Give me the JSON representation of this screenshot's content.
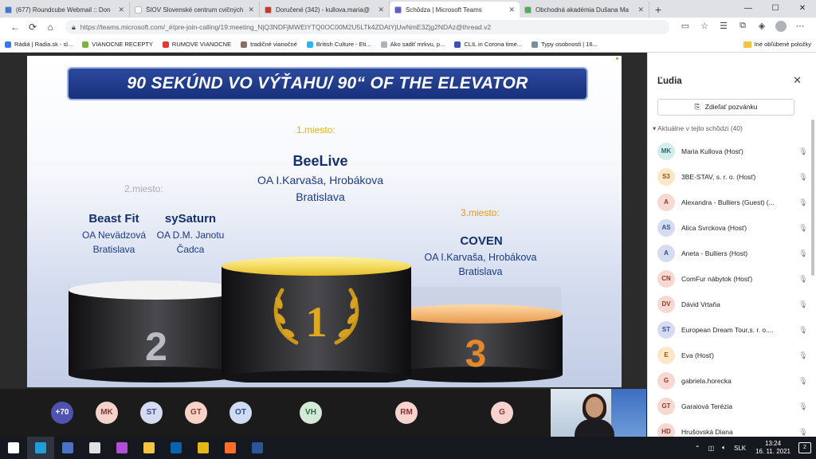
{
  "browser": {
    "tabs": [
      {
        "label": "(677) Roundcube Webmail :: Don",
        "color": "#3b78e7",
        "active": false
      },
      {
        "label": "ŠIOV Slovenské centrum cvičných",
        "color": "#ffffff",
        "active": false
      },
      {
        "label": "Doručené (342) - kullova.maria@",
        "color": "#d93025",
        "active": false
      },
      {
        "label": "Schôdza | Microsoft Teams",
        "color": "#5b5fc7",
        "active": true
      },
      {
        "label": "Obchodná akadémia Dušana Ma",
        "color": "#4caf50",
        "active": false
      }
    ],
    "url": "https://teams.microsoft.com/_#/pre-join-calling/19:meeting_NjQ3NDFjMWEtYTQ0OC00M2U5LTk4ZDAtYjUwNmE3Zjg2NDAz@thread.v2",
    "bookmarks": [
      {
        "label": "Rádiá | Radia.sk - sl...",
        "color": "#3b78e7"
      },
      {
        "label": "VIANOCNE RECEPTY",
        "color": "#7cb342"
      },
      {
        "label": "RUMOVE VIANOCNE",
        "color": "#e53935"
      },
      {
        "label": "tradičné vianočné",
        "color": "#8d6e63"
      },
      {
        "label": "British Culture - Eti...",
        "color": "#29b6f6"
      },
      {
        "label": "Ako sadiť mrkvu, p...",
        "color": "#aab4be"
      },
      {
        "label": "CLIL in Corona time...",
        "color": "#3f51b5"
      },
      {
        "label": "Typy osobnosti | 16...",
        "color": "#78909c"
      }
    ],
    "other_bookmarks": "Iné obľúbené položky"
  },
  "slide": {
    "title": "90 SEKÚND VO VÝŤAHU/ 90“ OF THE ELEVATOR",
    "first_place_label": "1.miesto:",
    "second_place_label": "2.miesto:",
    "third_place_label": "3.miesto:",
    "first": {
      "team": "BeeLive",
      "school": "OA I.Karvaša, Hrobákova",
      "city": "Bratislava"
    },
    "second_a": {
      "team": "Beast Fit",
      "school": "OA Nevädzová",
      "city": "Bratislava"
    },
    "second_b": {
      "team": "sySaturn",
      "school": "OA D.M. Janotu",
      "city": "Čadca"
    },
    "third": {
      "team": "COVEN",
      "school": "OA I.Karvaša, Hrobákova",
      "city": "Bratislava"
    },
    "podium_numbers": {
      "first": "1",
      "second": "2",
      "third": "3"
    }
  },
  "strip": {
    "overflow": "+70",
    "avatars": [
      {
        "initials": "MK",
        "bg": "#f4d3cc",
        "fg": "#8a3b2d"
      },
      {
        "initials": "ST",
        "bg": "#d5dcf2",
        "fg": "#3a4e8c"
      },
      {
        "initials": "GT",
        "bg": "#f6d3c6",
        "fg": "#8a3b2d"
      },
      {
        "initials": "OT",
        "bg": "#cfdcf3",
        "fg": "#2f4f8f"
      },
      {
        "initials": "VH",
        "bg": "#d3ead8",
        "fg": "#2f6a3d"
      },
      {
        "initials": "RM",
        "bg": "#f6d3cf",
        "fg": "#8a2f2d"
      },
      {
        "initials": "G",
        "bg": "#f6d3cf",
        "fg": "#8a2f2d"
      }
    ]
  },
  "people_panel": {
    "title": "Ľudia",
    "share_button": "Zdieľať pozvánku",
    "group_header": "Aktuálne v tejto schôdzi (40)",
    "participants": [
      {
        "initials": "MK",
        "name": "Maria Kullova (Hosť)",
        "bg": "#d3ecec",
        "fg": "#2b6b6b"
      },
      {
        "initials": "S3",
        "name": "3BE-STAV, s. r. o. (Hosť)",
        "bg": "#fbe7c6",
        "fg": "#8a5a10"
      },
      {
        "initials": "A",
        "name": "Alexandra - Bulliers (Guest) (...",
        "bg": "#f7d9d2",
        "fg": "#8a3b2d"
      },
      {
        "initials": "AS",
        "name": "Alica Svrckova (Hosť)",
        "bg": "#d5dcf2",
        "fg": "#3a4e8c"
      },
      {
        "initials": "A",
        "name": "Aneta - Bulliers (Host)",
        "bg": "#d5dcf2",
        "fg": "#3a4e8c"
      },
      {
        "initials": "CN",
        "name": "ComFur nábytok (Hosť)",
        "bg": "#f7d9d2",
        "fg": "#8a3b2d"
      },
      {
        "initials": "DV",
        "name": "Dávid Vrtaňa",
        "bg": "#f7d9d2",
        "fg": "#8a3b2d"
      },
      {
        "initials": "ST",
        "name": "European Dream Tour,s. r. o....",
        "bg": "#d5dcf2",
        "fg": "#3a4e8c"
      },
      {
        "initials": "E",
        "name": "Eva (Hosť)",
        "bg": "#fbe7c6",
        "fg": "#8a5a10"
      },
      {
        "initials": "G",
        "name": "gabriela.horecka",
        "bg": "#f7d9d2",
        "fg": "#8a3b2d"
      },
      {
        "initials": "GT",
        "name": "Garaiová Terézia",
        "bg": "#f7d9d2",
        "fg": "#8a3b2d"
      },
      {
        "initials": "HD",
        "name": "Hrušovská Diana",
        "bg": "#f7d9d2",
        "fg": "#8a3b2d"
      }
    ]
  },
  "taskbar": {
    "apps": [
      {
        "name": "windows-start-icon",
        "color": "#ffffff"
      },
      {
        "name": "edge-icon",
        "color": "#1f9ed8"
      },
      {
        "name": "save-icon",
        "color": "#4a72c8"
      },
      {
        "name": "lock-icon",
        "color": "#e0e0e0"
      },
      {
        "name": "store-icon",
        "color": "#b34fd4"
      },
      {
        "name": "folder-icon",
        "color": "#f5c542"
      },
      {
        "name": "outlook-icon",
        "color": "#0a64ad"
      },
      {
        "name": "chrome-icon",
        "color": "#e6b517"
      },
      {
        "name": "firefox-icon",
        "color": "#ff6d2c"
      },
      {
        "name": "word-icon",
        "color": "#2b579a"
      }
    ],
    "language": "SLK",
    "time": "13:24",
    "date": "16. 11. 2021",
    "notifications": "2"
  }
}
